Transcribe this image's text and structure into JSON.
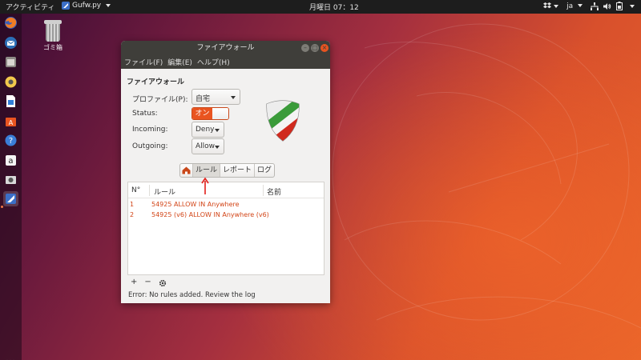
{
  "top_panel": {
    "activities": "アクティビティ",
    "app_name": "Gufw.py",
    "clock": "月曜日 07：12",
    "lang": "ja"
  },
  "desktop": {
    "trash_label": "ゴミ箱"
  },
  "dock": {
    "items": [
      "firefox-icon",
      "thunderbird-icon",
      "files-icon",
      "rhythmbox-icon",
      "libreoffice-writer-icon",
      "software-center-icon",
      "help-icon",
      "amazon-icon",
      "screenshot-icon",
      "gufw-icon"
    ]
  },
  "window": {
    "title": "ファイアウォール",
    "menu": [
      "ファイル(F)",
      "編集(E)",
      "ヘルプ(H)"
    ],
    "section_title": "ファイアウォール",
    "profile_label": "プロファイル(P):",
    "profile_value": "自宅",
    "status_label": "Status:",
    "status_value": "オン",
    "incoming_label": "Incoming:",
    "incoming_value": "Deny",
    "outgoing_label": "Outgoing:",
    "outgoing_value": "Allow",
    "tabs": [
      "ルール",
      "レポート",
      "ログ"
    ],
    "active_tab": "ルール",
    "columns": [
      "N°",
      "ルール",
      "名前"
    ],
    "rules": [
      {
        "num": "1",
        "rule": "54925 ALLOW IN Anywhere"
      },
      {
        "num": "2",
        "rule": "54925 (v6) ALLOW IN Anywhere (v6)"
      }
    ],
    "toolbar": {
      "add": "+",
      "remove": "−"
    },
    "status_text": "Error: No rules added. Review the log"
  },
  "colors": {
    "accent": "#e95420",
    "rule_text": "#d24416",
    "titlebar": "#3f3e3a"
  }
}
